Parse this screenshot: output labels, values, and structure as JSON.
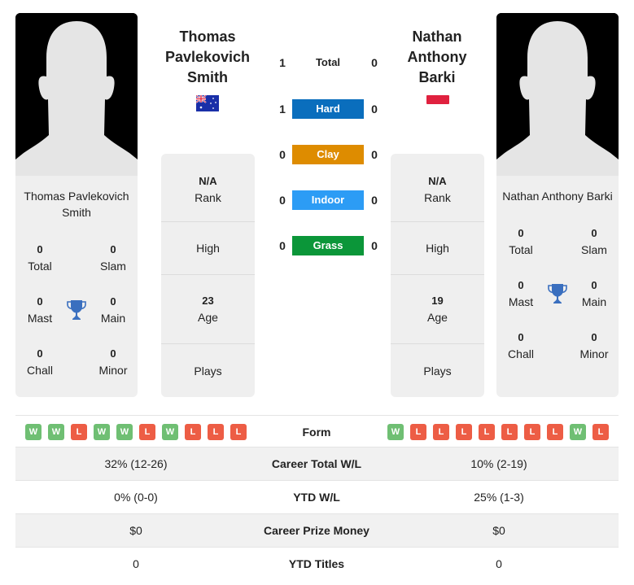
{
  "player1": {
    "name_lines": [
      "Thomas",
      "Pavlekovich",
      "Smith"
    ],
    "card_name_lines": [
      "Thomas Pavlekovich",
      "Smith"
    ],
    "flag": "australia-flag",
    "titles": {
      "total": {
        "value": "0",
        "label": "Total"
      },
      "slam": {
        "value": "0",
        "label": "Slam"
      },
      "mast": {
        "value": "0",
        "label": "Mast"
      },
      "main": {
        "value": "0",
        "label": "Main"
      },
      "chall": {
        "value": "0",
        "label": "Chall"
      },
      "minor": {
        "value": "0",
        "label": "Minor"
      }
    },
    "rank": {
      "value": "N/A",
      "label": "Rank"
    },
    "high": {
      "label": "High"
    },
    "age": {
      "value": "23",
      "label": "Age"
    },
    "plays": {
      "label": "Plays"
    },
    "form": [
      "W",
      "W",
      "L",
      "W",
      "W",
      "L",
      "W",
      "L",
      "L",
      "L"
    ]
  },
  "player2": {
    "name_lines": [
      "Nathan",
      "Anthony",
      "Barki"
    ],
    "card_name_lines": [
      "Nathan Anthony Barki"
    ],
    "flag": "red-flag",
    "titles": {
      "total": {
        "value": "0",
        "label": "Total"
      },
      "slam": {
        "value": "0",
        "label": "Slam"
      },
      "mast": {
        "value": "0",
        "label": "Mast"
      },
      "main": {
        "value": "0",
        "label": "Main"
      },
      "chall": {
        "value": "0",
        "label": "Chall"
      },
      "minor": {
        "value": "0",
        "label": "Minor"
      }
    },
    "rank": {
      "value": "N/A",
      "label": "Rank"
    },
    "high": {
      "label": "High"
    },
    "age": {
      "value": "19",
      "label": "Age"
    },
    "plays": {
      "label": "Plays"
    },
    "form": [
      "W",
      "L",
      "L",
      "L",
      "L",
      "L",
      "L",
      "L",
      "W",
      "L"
    ]
  },
  "h2h": [
    {
      "surface": "Total",
      "left": "1",
      "right": "0",
      "color": ""
    },
    {
      "surface": "Hard",
      "left": "1",
      "right": "0",
      "color": "#0a6ebd"
    },
    {
      "surface": "Clay",
      "left": "0",
      "right": "0",
      "color": "#de8c00"
    },
    {
      "surface": "Indoor",
      "left": "0",
      "right": "0",
      "color": "#2c9cf5"
    },
    {
      "surface": "Grass",
      "left": "0",
      "right": "0",
      "color": "#0b9639"
    }
  ],
  "form_label": "Form",
  "stats": [
    {
      "label": "Career Total W/L",
      "left": "32% (12-26)",
      "right": "10% (2-19)"
    },
    {
      "label": "YTD W/L",
      "left": "0% (0-0)",
      "right": "25% (1-3)"
    },
    {
      "label": "Career Prize Money",
      "left": "$0",
      "right": "$0"
    },
    {
      "label": "YTD Titles",
      "left": "0",
      "right": "0"
    }
  ],
  "colors": {
    "win": "#6fbf73",
    "loss": "#ed5d45",
    "trophy": "#3a6fbf",
    "card_bg": "#efefef"
  }
}
